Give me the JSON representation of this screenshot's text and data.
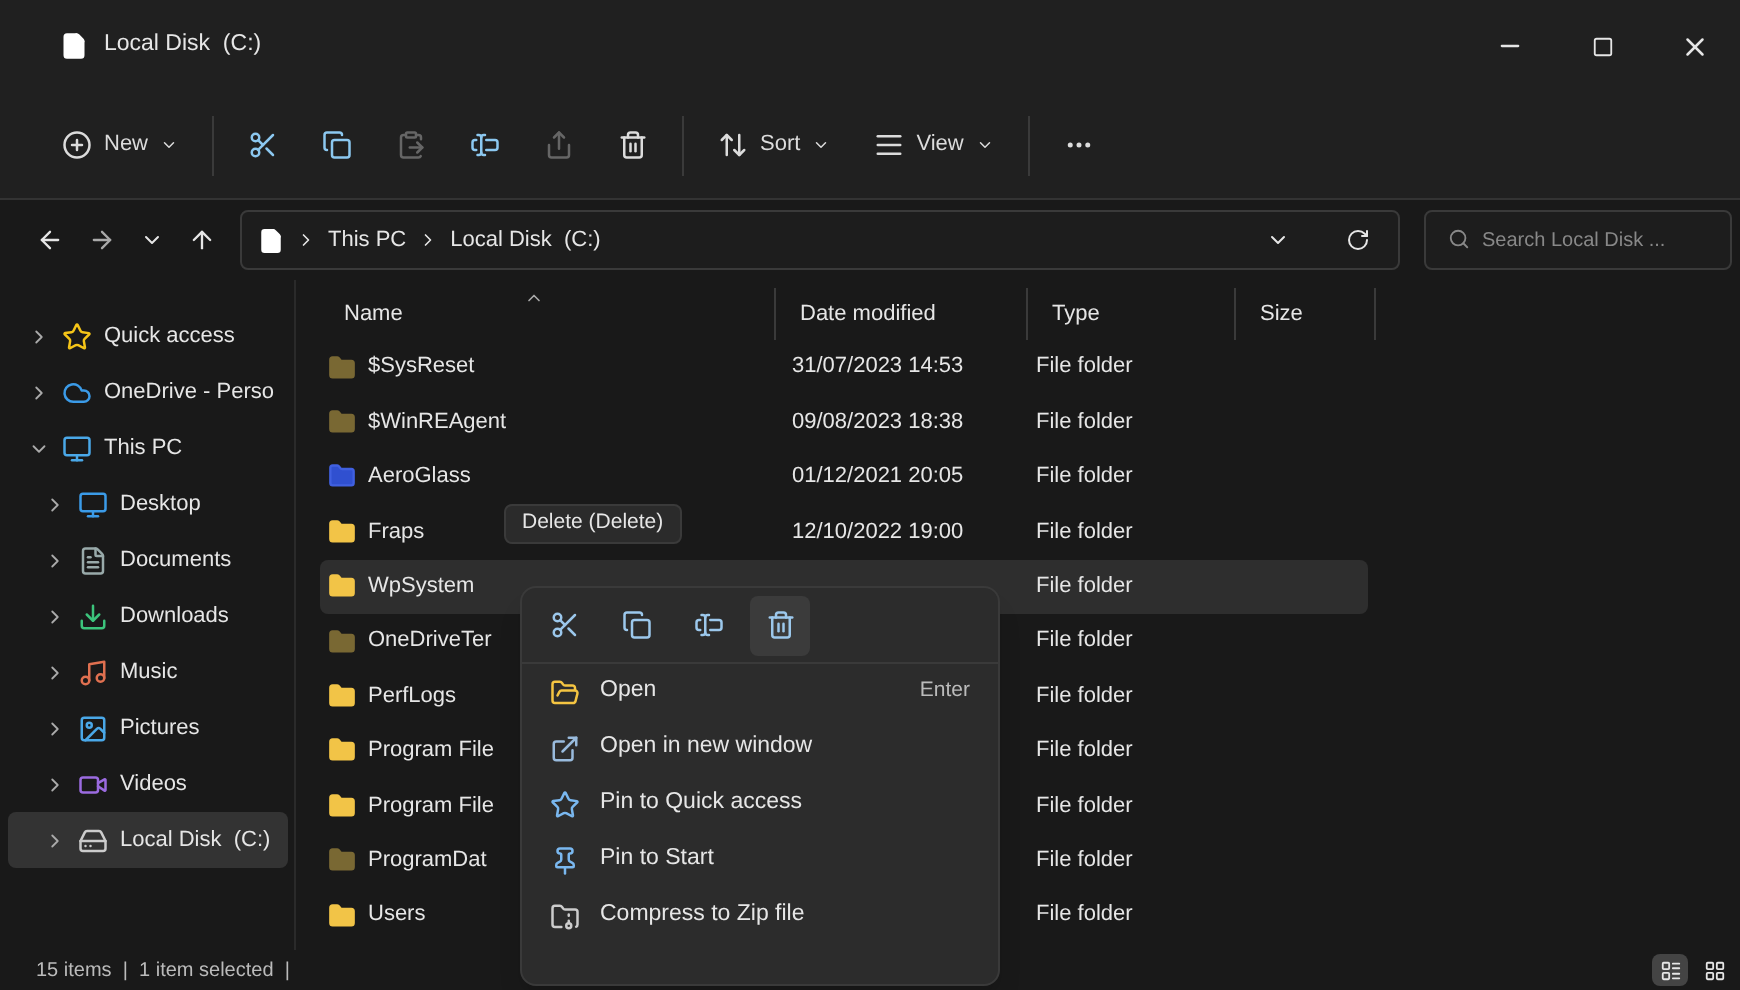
{
  "window": {
    "title": "Local Disk  (C:)"
  },
  "toolbar": [
    {
      "kind": "new",
      "label": "New",
      "disabled": false
    },
    {
      "kind": "cut",
      "disabled": false
    },
    {
      "kind": "copy",
      "disabled": false
    },
    {
      "kind": "paste",
      "disabled": true
    },
    {
      "kind": "rename",
      "disabled": false
    },
    {
      "kind": "share",
      "disabled": true
    },
    {
      "kind": "delete",
      "disabled": false
    },
    {
      "kind": "sort",
      "label": "Sort",
      "disabled": false
    },
    {
      "kind": "view",
      "label": "View",
      "disabled": false
    },
    {
      "kind": "more",
      "disabled": false
    }
  ],
  "address_bar": {
    "path": [
      "This PC",
      "Local Disk  (C:)"
    ]
  },
  "search": {
    "placeholder": "Search Local Disk ..."
  },
  "sidebar": {
    "items": [
      {
        "label": "Quick access",
        "expanded": false,
        "selected": false
      },
      {
        "label": "OneDrive - Perso",
        "expanded": false,
        "selected": false
      },
      {
        "label": "This PC",
        "expanded": true,
        "selected": false,
        "children": [
          {
            "label": "Desktop",
            "expanded": false,
            "selected": false
          },
          {
            "label": "Documents",
            "expanded": false,
            "selected": false
          },
          {
            "label": "Downloads",
            "expanded": false,
            "selected": false
          },
          {
            "label": "Music",
            "expanded": false,
            "selected": false
          },
          {
            "label": "Pictures",
            "expanded": false,
            "selected": false
          },
          {
            "label": "Videos",
            "expanded": false,
            "selected": false
          },
          {
            "label": "Local Disk  (C:)",
            "expanded": false,
            "selected": true
          }
        ]
      }
    ]
  },
  "table": {
    "columns": [
      {
        "label": "Name",
        "sorted": true
      },
      {
        "label": "Date modified",
        "sorted": false
      },
      {
        "label": "Type",
        "sorted": false
      },
      {
        "label": "Size",
        "sorted": false
      }
    ],
    "rows": [
      {
        "name": "$SysReset",
        "date": "31/07/2023 14:53",
        "type": "File folder",
        "hidden": true,
        "selected": false
      },
      {
        "name": "$WinREAgent",
        "date": "09/08/2023 18:38",
        "type": "File folder",
        "hidden": true,
        "selected": false
      },
      {
        "name": "AeroGlass",
        "date": "01/12/2021 20:05",
        "type": "File folder",
        "hidden": false,
        "selected": false
      },
      {
        "name": "Fraps",
        "date": "12/10/2022 19:00",
        "type": "File folder",
        "hidden": false,
        "selected": false
      },
      {
        "name": "WpSystem",
        "type": "File folder",
        "hidden": false,
        "selected": true
      },
      {
        "name": "OneDriveTer",
        "type": "File folder",
        "hidden": true,
        "selected": false
      },
      {
        "name": "PerfLogs",
        "type": "File folder",
        "hidden": false,
        "selected": false
      },
      {
        "name": "Program File",
        "type": "File folder",
        "hidden": false,
        "selected": false
      },
      {
        "name": "Program File",
        "type": "File folder",
        "hidden": false,
        "selected": false
      },
      {
        "name": "ProgramDat",
        "type": "File folder",
        "hidden": true,
        "selected": false
      },
      {
        "name": "Users",
        "type": "File folder",
        "hidden": false,
        "selected": false
      }
    ]
  },
  "context_menu": {
    "quick_actions": [
      {
        "kind": "cut",
        "highlighted": false
      },
      {
        "kind": "copy",
        "highlighted": false
      },
      {
        "kind": "rename",
        "highlighted": false
      },
      {
        "kind": "delete",
        "highlighted": true
      }
    ],
    "tooltip": "Delete (Delete)",
    "items": [
      {
        "label": "Open",
        "shortcut": "Enter"
      },
      {
        "label": "Open in new window"
      },
      {
        "label": "Pin to Quick access"
      },
      {
        "label": "Pin to Start"
      },
      {
        "label": "Compress to Zip file"
      }
    ]
  },
  "status_bar": {
    "text": "15 items  |  1 item selected  |",
    "view_modes": [
      {
        "kind": "details",
        "selected": true
      },
      {
        "kind": "tiles",
        "selected": false
      }
    ]
  }
}
